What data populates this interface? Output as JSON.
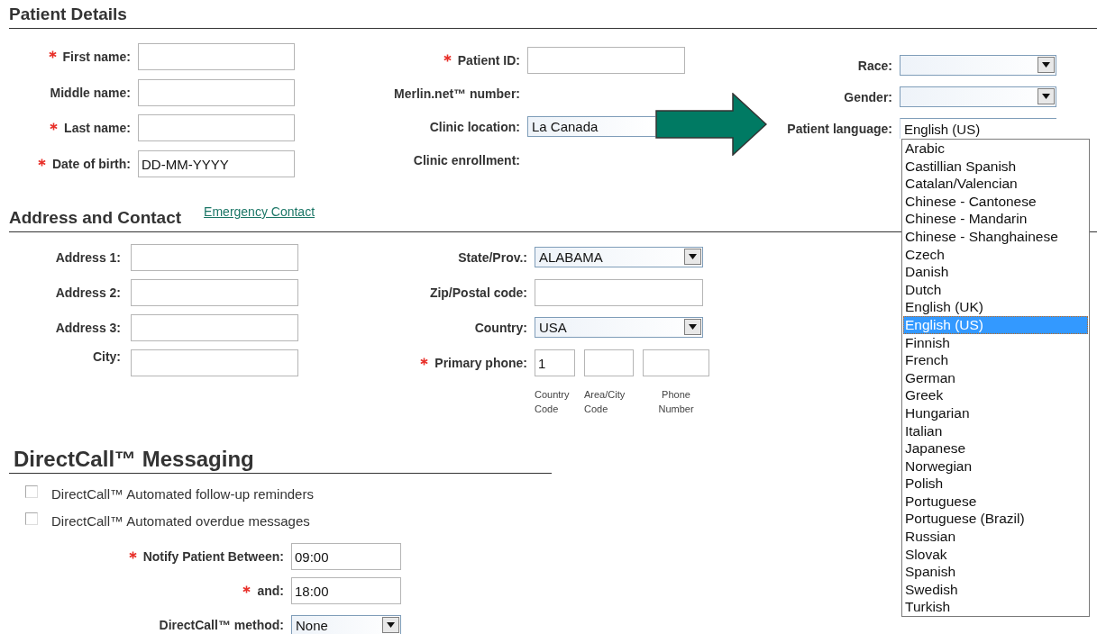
{
  "patient_details": {
    "title": "Patient Details",
    "columns": [
      {
        "fields": [
          {
            "label": "First name:",
            "required": true,
            "kind": "text"
          },
          {
            "label": "Middle name:",
            "required": false,
            "kind": "text"
          },
          {
            "label": "Last name:",
            "required": true,
            "kind": "text"
          },
          {
            "label": "Date of birth:",
            "required": true,
            "kind": "text",
            "value": "DD-MM-YYYY"
          }
        ]
      },
      {
        "fields": [
          {
            "label": "Patient ID:",
            "required": true,
            "kind": "text"
          },
          {
            "label": "Merlin.net™ number:",
            "required": false,
            "kind": "static"
          },
          {
            "label": "Clinic location:",
            "required": false,
            "kind": "combo",
            "value": "La Canada"
          },
          {
            "label": "Clinic enrollment:",
            "required": false,
            "kind": "static"
          }
        ]
      },
      {
        "fields": [
          {
            "label": "Race:",
            "required": false,
            "kind": "select",
            "expanded": false
          },
          {
            "label": "Gender:",
            "required": false,
            "kind": "select",
            "expanded": false
          },
          {
            "label": "Patient language:",
            "required": false,
            "kind": "select",
            "expanded": true,
            "value": "English (US)",
            "options": [
              {
                "label": "Arabic",
                "selected": false
              },
              {
                "label": "Castillian Spanish",
                "selected": false
              },
              {
                "label": "Catalan/Valencian",
                "selected": false
              },
              {
                "label": "Chinese - Cantonese",
                "selected": false
              },
              {
                "label": "Chinese - Mandarin",
                "selected": false
              },
              {
                "label": "Chinese - Shanghainese",
                "selected": false
              },
              {
                "label": "Czech",
                "selected": false
              },
              {
                "label": "Danish",
                "selected": false
              },
              {
                "label": "Dutch",
                "selected": false
              },
              {
                "label": "English (UK)",
                "selected": false
              },
              {
                "label": "English (US)",
                "selected": true
              },
              {
                "label": "Finnish",
                "selected": false
              },
              {
                "label": "French",
                "selected": false
              },
              {
                "label": "German",
                "selected": false
              },
              {
                "label": "Greek",
                "selected": false
              },
              {
                "label": "Hungarian",
                "selected": false
              },
              {
                "label": "Italian",
                "selected": false
              },
              {
                "label": "Japanese",
                "selected": false
              },
              {
                "label": "Norwegian",
                "selected": false
              },
              {
                "label": "Polish",
                "selected": false
              },
              {
                "label": "Portuguese",
                "selected": false
              },
              {
                "label": "Portuguese (Brazil)",
                "selected": false
              },
              {
                "label": "Russian",
                "selected": false
              },
              {
                "label": "Slovak",
                "selected": false
              },
              {
                "label": "Spanish",
                "selected": false
              },
              {
                "label": "Swedish",
                "selected": false
              },
              {
                "label": "Turkish",
                "selected": false
              }
            ]
          }
        ]
      }
    ]
  },
  "address_contact": {
    "title": "Address and Contact",
    "link": "Emergency Contact",
    "columns": [
      {
        "fields": [
          {
            "label": "Address 1:",
            "required": false,
            "kind": "text"
          },
          {
            "label": "Address 2:",
            "required": false,
            "kind": "text"
          },
          {
            "label": "Address 3:",
            "required": false,
            "kind": "text"
          },
          {
            "label": "City:",
            "required": false,
            "kind": "text"
          }
        ]
      },
      {
        "fields": [
          {
            "label": "State/Prov.:",
            "required": false,
            "kind": "select",
            "expanded": false,
            "value": "ALABAMA"
          },
          {
            "label": "Zip/Postal code:",
            "required": false,
            "kind": "text"
          },
          {
            "label": "Country:",
            "required": false,
            "kind": "select",
            "expanded": false,
            "value": "USA"
          },
          {
            "label": "Primary phone:",
            "required": true,
            "kind": "phone",
            "parts": [
              {
                "value": "1",
                "caption": "Country Code"
              },
              {
                "caption": "Area/City Code"
              },
              {
                "caption": "Phone Number"
              }
            ]
          }
        ]
      }
    ]
  },
  "directcall": {
    "title": "DirectCall™ Messaging",
    "checkboxes": [
      {
        "label": "DirectCall™ Automated follow-up reminders",
        "checked": false
      },
      {
        "label": "DirectCall™ Automated overdue messages",
        "checked": false
      }
    ],
    "fields": [
      {
        "label": "Notify Patient Between:",
        "required": true,
        "kind": "text",
        "value": "09:00"
      },
      {
        "label": "and:",
        "required": true,
        "kind": "text",
        "value": "18:00"
      },
      {
        "label": "DirectCall™ method:",
        "required": false,
        "kind": "select",
        "expanded": false,
        "value": "None"
      }
    ]
  }
}
